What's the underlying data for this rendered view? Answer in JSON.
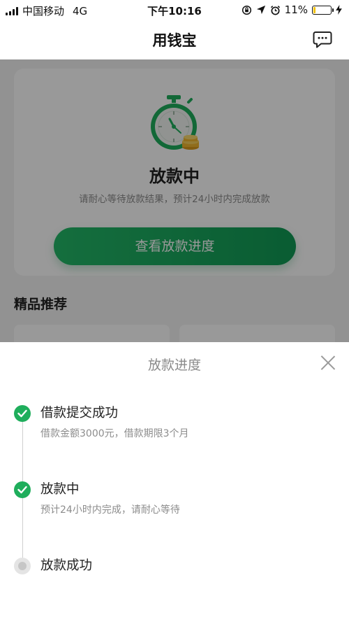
{
  "status_bar": {
    "carrier": "中国移动",
    "network": "4G",
    "time": "下午10:16",
    "battery_percent": "11%",
    "battery_level": 0.11
  },
  "nav": {
    "title": "用钱宝"
  },
  "status_card": {
    "title": "放款中",
    "subtitle": "请耐心等待放款结果，预计24小时内完成放款",
    "button_label": "查看放款进度"
  },
  "recommend": {
    "title": "精品推荐"
  },
  "sheet": {
    "title": "放款进度",
    "steps": [
      {
        "title": "借款提交成功",
        "desc": "借款金额3000元，借款期限3个月",
        "state": "done"
      },
      {
        "title": "放款中",
        "desc": "预计24小时内完成，请耐心等待",
        "state": "done"
      },
      {
        "title": "放款成功",
        "desc": "",
        "state": "pending"
      }
    ]
  },
  "colors": {
    "accent_green": "#1fae5c",
    "battery_yellow": "#f2c200"
  }
}
